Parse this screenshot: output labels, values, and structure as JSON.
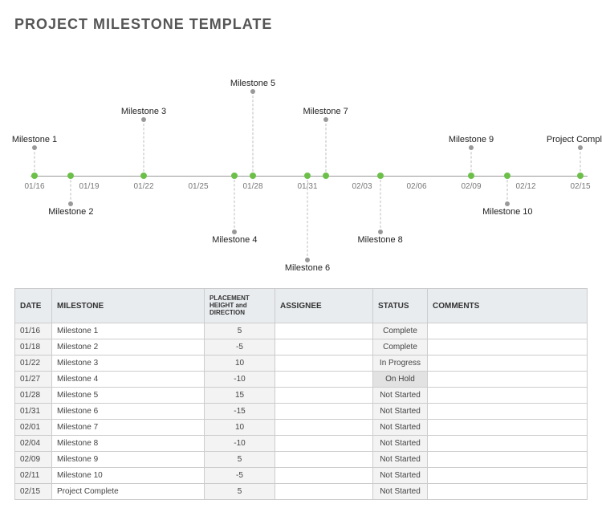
{
  "title": "PROJECT MILESTONE TEMPLATE",
  "chart_data": {
    "type": "scatter",
    "title": "",
    "xlabel": "",
    "ylabel": "",
    "x_ticks": [
      "01/16",
      "01/19",
      "01/22",
      "01/25",
      "01/28",
      "01/31",
      "02/03",
      "02/06",
      "02/09",
      "02/12",
      "02/15"
    ],
    "ylim": [
      -16,
      16
    ],
    "series": [
      {
        "name": "Milestone 1",
        "x": "01/16",
        "y": 5
      },
      {
        "name": "Milestone 2",
        "x": "01/18",
        "y": -5
      },
      {
        "name": "Milestone 3",
        "x": "01/22",
        "y": 10
      },
      {
        "name": "Milestone 4",
        "x": "01/27",
        "y": -10
      },
      {
        "name": "Milestone 5",
        "x": "01/28",
        "y": 15
      },
      {
        "name": "Milestone 6",
        "x": "01/31",
        "y": -15
      },
      {
        "name": "Milestone 7",
        "x": "02/01",
        "y": 10
      },
      {
        "name": "Milestone 8",
        "x": "02/04",
        "y": -10
      },
      {
        "name": "Milestone 9",
        "x": "02/09",
        "y": 5
      },
      {
        "name": "Milestone 10",
        "x": "02/11",
        "y": -5
      },
      {
        "name": "Project Complete",
        "x": "02/15",
        "y": 5
      }
    ]
  },
  "table": {
    "headers": {
      "date": "DATE",
      "milestone": "MILESTONE",
      "placement": "PLACEMENT HEIGHT and DIRECTION",
      "assignee": "ASSIGNEE",
      "status": "STATUS",
      "comments": "COMMENTS"
    },
    "rows": [
      {
        "date": "01/16",
        "milestone": "Milestone 1",
        "placement": "5",
        "assignee": "",
        "status": "Complete",
        "comments": ""
      },
      {
        "date": "01/18",
        "milestone": "Milestone 2",
        "placement": "-5",
        "assignee": "",
        "status": "Complete",
        "comments": ""
      },
      {
        "date": "01/22",
        "milestone": "Milestone 3",
        "placement": "10",
        "assignee": "",
        "status": "In Progress",
        "comments": ""
      },
      {
        "date": "01/27",
        "milestone": "Milestone 4",
        "placement": "-10",
        "assignee": "",
        "status": "On Hold",
        "comments": ""
      },
      {
        "date": "01/28",
        "milestone": "Milestone 5",
        "placement": "15",
        "assignee": "",
        "status": "Not Started",
        "comments": ""
      },
      {
        "date": "01/31",
        "milestone": "Milestone 6",
        "placement": "-15",
        "assignee": "",
        "status": "Not Started",
        "comments": ""
      },
      {
        "date": "02/01",
        "milestone": "Milestone 7",
        "placement": "10",
        "assignee": "",
        "status": "Not Started",
        "comments": ""
      },
      {
        "date": "02/04",
        "milestone": "Milestone 8",
        "placement": "-10",
        "assignee": "",
        "status": "Not Started",
        "comments": ""
      },
      {
        "date": "02/09",
        "milestone": "Milestone 9",
        "placement": "5",
        "assignee": "",
        "status": "Not Started",
        "comments": ""
      },
      {
        "date": "02/11",
        "milestone": "Milestone 10",
        "placement": "-5",
        "assignee": "",
        "status": "Not Started",
        "comments": ""
      },
      {
        "date": "02/15",
        "milestone": "Project Complete",
        "placement": "5",
        "assignee": "",
        "status": "Not Started",
        "comments": ""
      }
    ]
  }
}
